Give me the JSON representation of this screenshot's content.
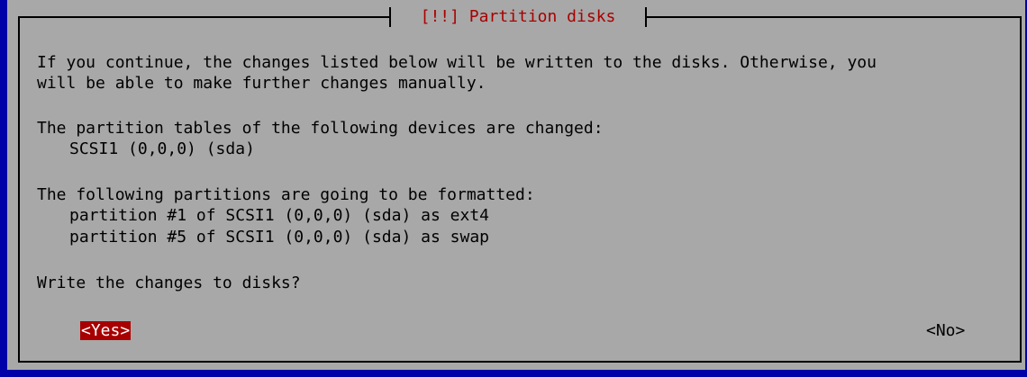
{
  "dialog": {
    "title": "[!!] Partition disks",
    "message_line1": "If you continue, the changes listed below will be written to the disks. Otherwise, you",
    "message_line2": "will be able to make further changes manually.",
    "tables_heading": "The partition tables of the following devices are changed:",
    "devices": [
      "SCSI1 (0,0,0) (sda)"
    ],
    "formatted_heading": "The following partitions are going to be formatted:",
    "partitions": [
      "partition #1 of SCSI1 (0,0,0) (sda) as ext4",
      "partition #5 of SCSI1 (0,0,0) (sda) as swap"
    ],
    "question": "Write the changes to disks?",
    "yes_label": "<Yes>",
    "no_label": "<No>"
  },
  "colors": {
    "background": "#0000a8",
    "dialog": "#a8a8a8",
    "accent": "#a80000",
    "text": "#000000"
  }
}
